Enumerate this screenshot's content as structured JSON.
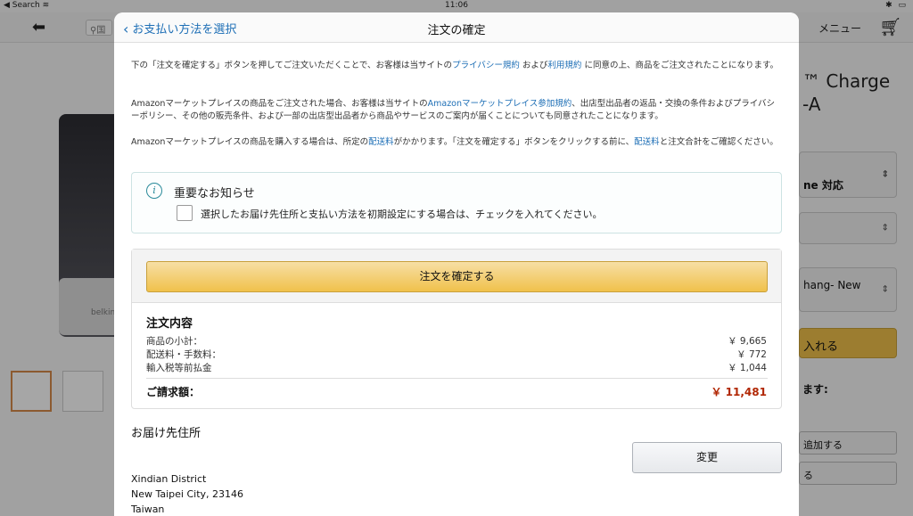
{
  "status_bar": {
    "back_app": "Search",
    "time": "11:06"
  },
  "background": {
    "search_text": "国",
    "menu_label": "メニュー",
    "cart_count": "1",
    "product_title_line1": "™ Charge",
    "product_title_line2": "-A",
    "option1": "ne 対応",
    "option3": "hang- New",
    "add_to_cart": "入れる",
    "ship_label": "ます:",
    "button1": "追加する",
    "button2": "る",
    "dock_brand": "belkin"
  },
  "modal": {
    "back_label": "お支払い方法を選択",
    "title": "注文の確定",
    "para1_pre": "下の「注文を確定する」ボタンを押してご注文いただくことで、お客様は当サイトの",
    "para1_link1": "プライバシー規約",
    "para1_mid": " および",
    "para1_link2": "利用規約",
    "para1_post": " に同意の上、商品をご注文されたことになります。",
    "para2_pre": "Amazonマーケットプレイスの商品をご注文された場合、お客様は当サイトの",
    "para2_link": "Amazonマーケットプレイス参加規約",
    "para2_post": "、出店型出品者の返品・交換の条件およびプライバシーポリシー、その他の販売条件、および一部の出店型出品者から商品やサービスのご案内が届くことについても同意されたことになります。",
    "para3_pre": "Amazonマーケットプレイスの商品を購入する場合は、所定の",
    "para3_link1": "配送料",
    "para3_mid": "がかかります。「注文を確定する」ボタンをクリックする前に、",
    "para3_link2": "配送料",
    "para3_post": "と注文合計をご確認ください。",
    "notice_title": "重要なお知らせ",
    "notice_checkbox_label": "選択したお届け先住所と支払い方法を初期設定にする場合は、チェックを入れてください。",
    "place_order_button": "注文を確定する",
    "summary": {
      "title": "注文内容",
      "rows": [
        {
          "label": "商品の小計：",
          "value": "￥ 9,665"
        },
        {
          "label": "配送料・手数料：",
          "value": "￥ 772"
        },
        {
          "label": "輸入税等前払金",
          "value": "￥ 1,044"
        }
      ],
      "total_label": "ご請求額：",
      "total_value": "￥ 11,481"
    },
    "address": {
      "title": "お届け先住所",
      "change_button": "変更",
      "lines": [
        "Xindian District",
        "New Taipei City, 23146",
        "Taiwan"
      ]
    }
  },
  "colors": {
    "link": "#1e6fb6",
    "button_primary": "#f0c14b",
    "total_price": "#b12704"
  }
}
